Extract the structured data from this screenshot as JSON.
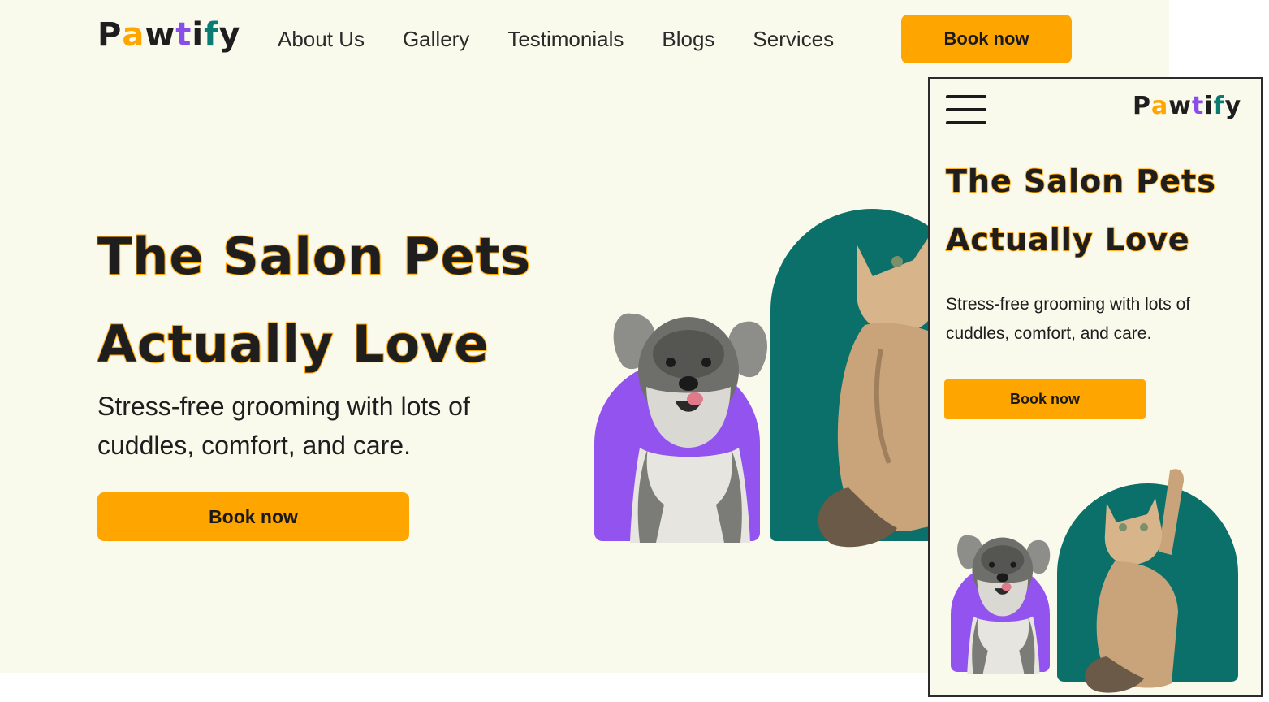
{
  "brand": {
    "logo_letters": [
      "P",
      "a",
      "w",
      "t",
      "i",
      "f",
      "y"
    ]
  },
  "nav": {
    "items": [
      "About Us",
      "Gallery",
      "Testimonials",
      "Blogs",
      "Services"
    ],
    "book_label": "Book now"
  },
  "hero": {
    "title_line1": "The Salon Pets",
    "title_line2": "Actually Love",
    "subtitle_line1": "Stress-free grooming with lots of",
    "subtitle_line2": "cuddles, comfort, and care.",
    "cta_label": "Book now"
  },
  "mobile": {
    "cta_label": "Book now"
  },
  "colors": {
    "background": "#f9f9ec",
    "accent": "#ffa500",
    "purple": "#9253ef",
    "teal": "#0a7069",
    "text": "#1e1e1e"
  },
  "icons": {
    "menu": "hamburger-icon",
    "dog": "dog-illustration",
    "cat": "cat-illustration"
  }
}
